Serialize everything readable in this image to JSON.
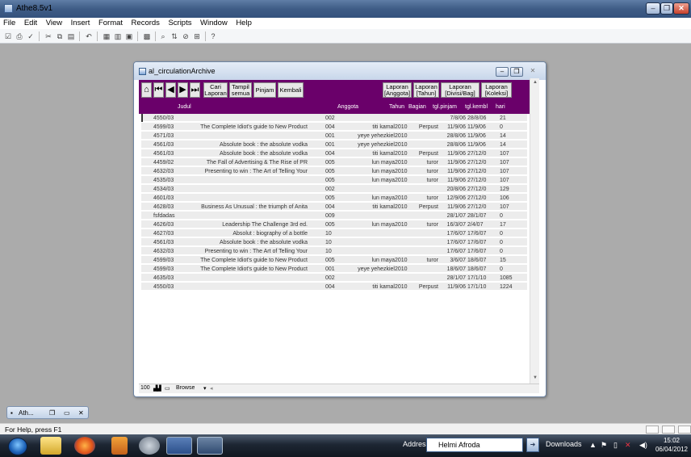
{
  "app": {
    "title": "Athe8.5v1"
  },
  "menu": [
    "File",
    "Edit",
    "View",
    "Insert",
    "Format",
    "Records",
    "Scripts",
    "Window",
    "Help"
  ],
  "child": {
    "title": "al_circulationArchive"
  },
  "nav": {
    "cari": "Cari\nLaporan",
    "tampil": "Tampil\nsemua",
    "pinjam": "Pinjam",
    "kembali": "Kembali",
    "lap_anggota": "Laporan\n[Anggota]",
    "lap_tahun": "Laporan\n[Tahun]",
    "lap_divisi": "Laporan\n[Divisi/Bag]",
    "lap_koleksi": "Laporan\n[Koleksi]"
  },
  "columns": {
    "judul": "Judul",
    "anggota": "Anggota",
    "tahun": "Tahun",
    "bagian": "Bagian",
    "pinjam": "tgl.pinjam",
    "kembali": "tgl.kembl",
    "hari": "hari"
  },
  "rows": [
    {
      "code": "4550/03",
      "judul": "",
      "ang": "002",
      "nama": "",
      "th": "",
      "bag": "",
      "pin": "7/8/06",
      "kem": "28/8/06",
      "hari": "21"
    },
    {
      "code": "4599/03",
      "judul": "The Complete Idiot's guide to New Product",
      "ang": "004",
      "nama": "titi kamal",
      "th": "2010",
      "bag": "Perpust",
      "pin": "11/9/06",
      "kem": "11/9/06",
      "hari": "0"
    },
    {
      "code": "4571/03",
      "judul": "",
      "ang": "001",
      "nama": "yeye yehezkiel",
      "th": "2010",
      "bag": "",
      "pin": "28/8/06",
      "kem": "11/9/06",
      "hari": "14"
    },
    {
      "code": "4561/03",
      "judul": "Absolute book : the absolute vodka",
      "ang": "001",
      "nama": "yeye yehezkiel",
      "th": "2010",
      "bag": "",
      "pin": "28/8/06",
      "kem": "11/9/06",
      "hari": "14"
    },
    {
      "code": "4561/03",
      "judul": "Absolute book : the absolute vodka",
      "ang": "004",
      "nama": "titi kamal",
      "th": "2010",
      "bag": "Perpust",
      "pin": "11/9/06",
      "kem": "27/12/0",
      "hari": "107"
    },
    {
      "code": "4459/02",
      "judul": "The Fall of Advertising & The Rise of PR",
      "ang": "005",
      "nama": "lun maya",
      "th": "2010",
      "bag": "turor",
      "pin": "11/9/06",
      "kem": "27/12/0",
      "hari": "107"
    },
    {
      "code": "4632/03",
      "judul": "Presenting to win : The Art of Telling Your",
      "ang": "005",
      "nama": "lun maya",
      "th": "2010",
      "bag": "turor",
      "pin": "11/9/06",
      "kem": "27/12/0",
      "hari": "107"
    },
    {
      "code": "4535/03",
      "judul": "",
      "ang": "005",
      "nama": "lun maya",
      "th": "2010",
      "bag": "turor",
      "pin": "11/9/06",
      "kem": "27/12/0",
      "hari": "107"
    },
    {
      "code": "4534/03",
      "judul": "",
      "ang": "002",
      "nama": "",
      "th": "",
      "bag": "",
      "pin": "20/8/06",
      "kem": "27/12/0",
      "hari": "129"
    },
    {
      "code": "4601/03",
      "judul": "",
      "ang": "005",
      "nama": "lun maya",
      "th": "2010",
      "bag": "turor",
      "pin": "12/9/06",
      "kem": "27/12/0",
      "hari": "106"
    },
    {
      "code": "4628/03",
      "judul": "Business As Unusual : the triumph of Anita",
      "ang": "004",
      "nama": "titi kamal",
      "th": "2010",
      "bag": "Perpust",
      "pin": "11/9/06",
      "kem": "27/12/0",
      "hari": "107"
    },
    {
      "code": "fsfdadas",
      "judul": "",
      "ang": "009",
      "nama": "",
      "th": "",
      "bag": "",
      "pin": "28/1/07",
      "kem": "28/1/07",
      "hari": "0"
    },
    {
      "code": "4626/03",
      "judul": "Leadership The Challenge 3rd ed.",
      "ang": "005",
      "nama": "lun maya",
      "th": "2010",
      "bag": "turor",
      "pin": "16/3/07",
      "kem": "2/4/07",
      "hari": "17"
    },
    {
      "code": "4627/03",
      "judul": "Absolut : biography of a bottle",
      "ang": "10",
      "nama": "",
      "th": "",
      "bag": "",
      "pin": "17/6/07",
      "kem": "17/6/07",
      "hari": "0"
    },
    {
      "code": "4561/03",
      "judul": "Absolute book : the absolute vodka",
      "ang": "10",
      "nama": "",
      "th": "",
      "bag": "",
      "pin": "17/6/07",
      "kem": "17/6/07",
      "hari": "0"
    },
    {
      "code": "4632/03",
      "judul": "Presenting to win : The Art of Telling Your",
      "ang": "10",
      "nama": "",
      "th": "",
      "bag": "",
      "pin": "17/6/07",
      "kem": "17/6/07",
      "hari": "0"
    },
    {
      "code": "4599/03",
      "judul": "The Complete Idiot's guide to New Product",
      "ang": "005",
      "nama": "lun maya",
      "th": "2010",
      "bag": "turor",
      "pin": "3/6/07",
      "kem": "18/6/07",
      "hari": "15"
    },
    {
      "code": "4599/03",
      "judul": "The Complete Idiot's guide to New Product",
      "ang": "001",
      "nama": "yeye yehezkiel",
      "th": "2010",
      "bag": "",
      "pin": "18/6/07",
      "kem": "18/6/07",
      "hari": "0"
    },
    {
      "code": "4635/03",
      "judul": "",
      "ang": "002",
      "nama": "",
      "th": "",
      "bag": "",
      "pin": "28/1/07",
      "kem": "17/1/10",
      "hari": "1085"
    },
    {
      "code": "4550/03",
      "judul": "",
      "ang": "004",
      "nama": "titi kamal",
      "th": "2010",
      "bag": "Perpust",
      "pin": "11/9/06",
      "kem": "17/1/10",
      "hari": "1224"
    }
  ],
  "child_status": {
    "zoom": "100",
    "mode": "Browse"
  },
  "minimized": {
    "label": "Ath..."
  },
  "statusbar": {
    "text": "For Help, press F1"
  },
  "taskbar": {
    "address_label": "Address",
    "address_value": "Helmi Afroda",
    "downloads": "Downloads",
    "time": "15:02",
    "date": "06/04/2012"
  }
}
